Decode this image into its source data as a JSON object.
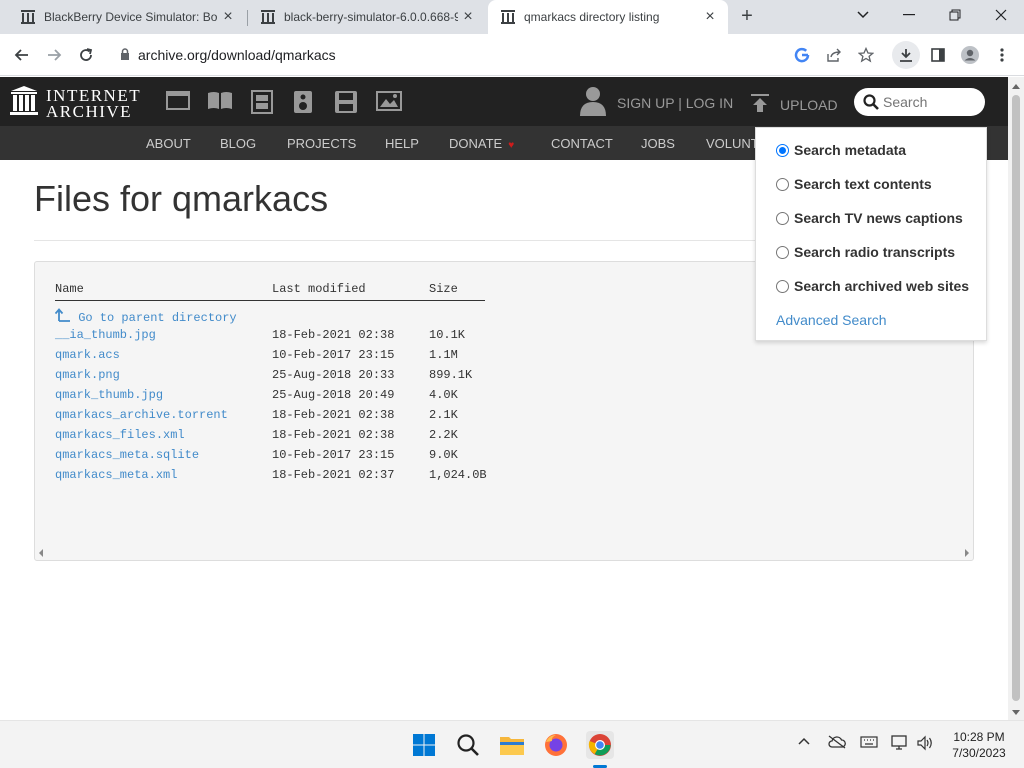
{
  "browser": {
    "tabs": [
      {
        "title": "BlackBerry Device Simulator: Bold"
      },
      {
        "title": "black-berry-simulator-6.0.0.668-9"
      },
      {
        "title": "qmarkacs directory listing"
      }
    ],
    "url": "archive.org/download/qmarkacs"
  },
  "ia": {
    "logo_line1": "INTERNET",
    "logo_line2": "ARCHIVE",
    "signup": "SIGN UP | LOG IN",
    "upload": "UPLOAD",
    "search_placeholder": "Search",
    "nav": [
      "ABOUT",
      "BLOG",
      "PROJECTS",
      "HELP",
      "DONATE",
      "CONTACT",
      "JOBS",
      "VOLUNT"
    ]
  },
  "page": {
    "title": "Files for qmarkacs",
    "columns": [
      "Name",
      "Last modified",
      "Size"
    ],
    "parent_link": "Go to parent directory",
    "files": [
      {
        "name": "__ia_thumb.jpg",
        "modified": "18-Feb-2021 02:38",
        "size": "10.1K"
      },
      {
        "name": "qmark.acs",
        "modified": "10-Feb-2017 23:15",
        "size": "1.1M"
      },
      {
        "name": "qmark.png",
        "modified": "25-Aug-2018 20:33",
        "size": "899.1K"
      },
      {
        "name": "qmark_thumb.jpg",
        "modified": "25-Aug-2018 20:49",
        "size": "4.0K"
      },
      {
        "name": "qmarkacs_archive.torrent",
        "modified": "18-Feb-2021 02:38",
        "size": "2.1K"
      },
      {
        "name": "qmarkacs_files.xml",
        "modified": "18-Feb-2021 02:38",
        "size": "2.2K"
      },
      {
        "name": "qmarkacs_meta.sqlite",
        "modified": "10-Feb-2017 23:15",
        "size": "9.0K"
      },
      {
        "name": "qmarkacs_meta.xml",
        "modified": "18-Feb-2021 02:37",
        "size": "1,024.0B"
      }
    ]
  },
  "search_dropdown": {
    "options": [
      {
        "label": "Search metadata",
        "selected": true
      },
      {
        "label": "Search text contents",
        "selected": false
      },
      {
        "label": "Search TV news captions",
        "selected": false
      },
      {
        "label": "Search radio transcripts",
        "selected": false
      },
      {
        "label": "Search archived web sites",
        "selected": false
      }
    ],
    "advanced": "Advanced Search"
  },
  "taskbar": {
    "time": "10:28 PM",
    "date": "7/30/2023"
  },
  "colors": {
    "link": "#428bca",
    "header_bg": "#222222",
    "nav_bg": "#333333",
    "radio_accent": "#0075ff"
  }
}
